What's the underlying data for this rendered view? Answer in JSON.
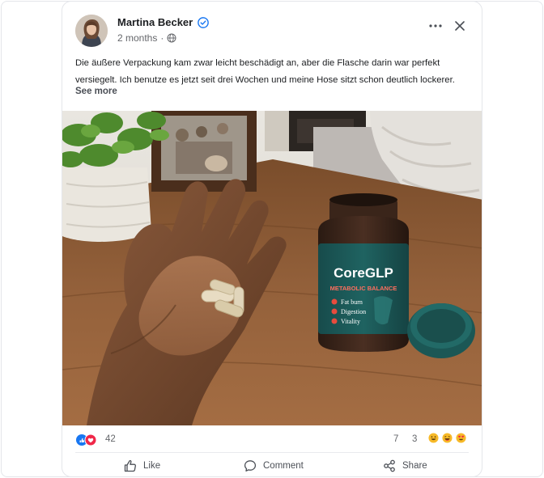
{
  "post": {
    "author": "Martina Becker",
    "time": "2 months",
    "separator": "·",
    "text": "Die äußere Verpackung kam zwar leicht beschädigt an, aber die Flasche darin war perfekt versiegelt. Ich benutze es jetzt seit drei Wochen und meine Hose sitzt schon deutlich lockerer.",
    "see_more": "See more"
  },
  "product": {
    "brand": "CoreGLP",
    "subtitle": "METABOLIC BALANCE",
    "features": [
      "Fat burn",
      "Digestion",
      "Vitality"
    ]
  },
  "stats": {
    "reactions": "42",
    "comments": "7",
    "shares": "3"
  },
  "actions": {
    "like": "Like",
    "comment": "Comment",
    "share": "Share"
  },
  "icons": {
    "verified": "verified-check-icon",
    "globe": "globe-icon",
    "more": "more-horizontal-icon",
    "close": "close-icon",
    "like": "thumbs-up-icon",
    "comment": "comment-bubble-icon",
    "share": "share-network-icon"
  },
  "colors": {
    "accent": "#1877f2",
    "reaction_red": "#f02849",
    "bottle_teal": "#1d5c5c",
    "wood": "#8a5a33"
  }
}
